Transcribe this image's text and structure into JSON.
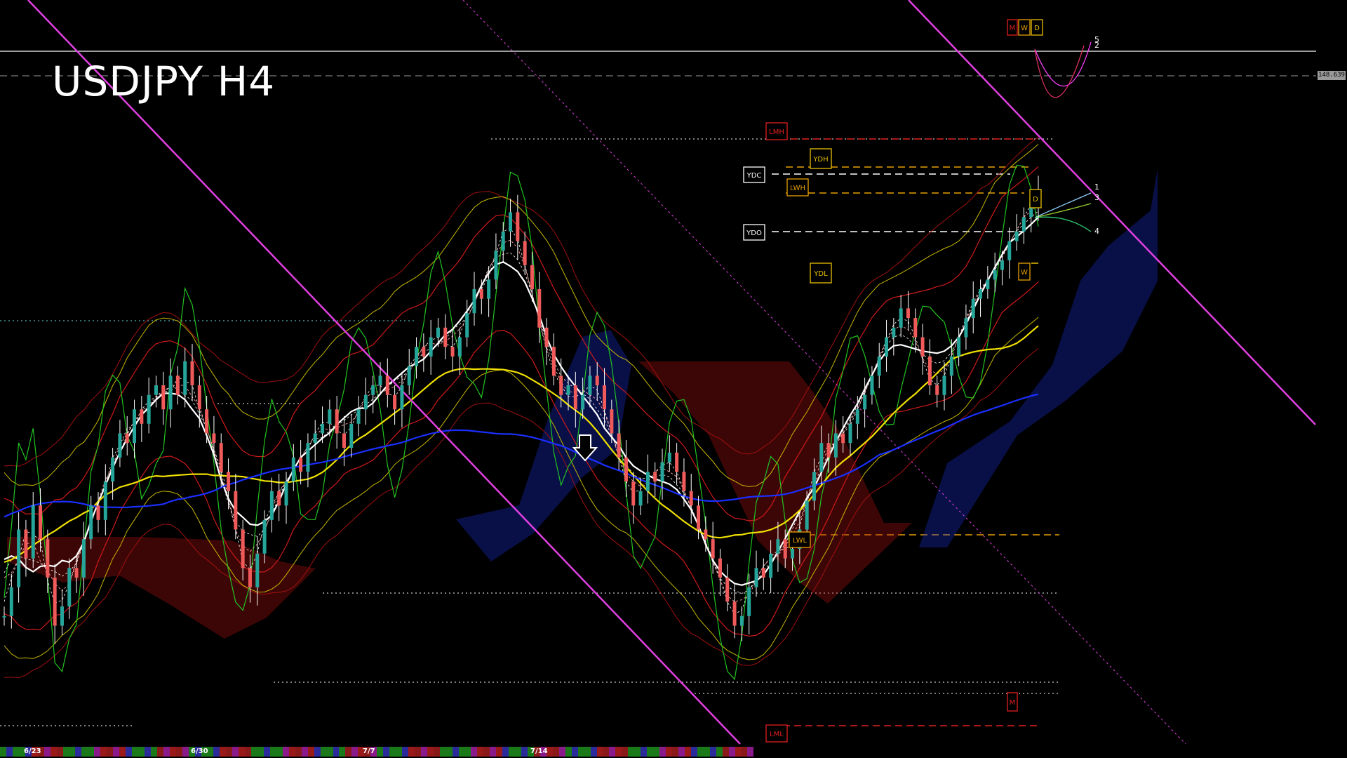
{
  "window": {
    "title": "USDJPY H4"
  },
  "price_tag": "148.639",
  "colors": {
    "bull": "#26a69a",
    "bear": "#f05a5a",
    "ma_white": "#ffffff",
    "ma_yellow": "#f0e000",
    "ma_blue": "#1a2fff",
    "channel": "#e040e0",
    "green_osc": "#22c422",
    "bollinger": "#d01a1a"
  },
  "x_axis_dates": [
    "6/23",
    "6/30",
    "7/7",
    "7/14"
  ],
  "level_boxes": [
    {
      "label": "M",
      "color": "#e02020"
    },
    {
      "label": "W",
      "color": "#e8a000"
    },
    {
      "label": "D",
      "color": "#e8c000"
    },
    {
      "label": "LMH",
      "color": "#e02020"
    },
    {
      "label": "YDH",
      "color": "#e8c000"
    },
    {
      "label": "YDC",
      "color": "#ffffff"
    },
    {
      "label": "LWH",
      "color": "#e8a000"
    },
    {
      "label": "YDO",
      "color": "#ffffff"
    },
    {
      "label": "YDL",
      "color": "#e8c000"
    },
    {
      "label": "LWL",
      "color": "#e8a000"
    },
    {
      "label": "D",
      "color": "#e8c000"
    },
    {
      "label": "W",
      "color": "#e8a000"
    },
    {
      "label": "M",
      "color": "#e02020"
    },
    {
      "label": "LML",
      "color": "#e02020"
    }
  ],
  "projection_labels": [
    "5",
    "2",
    "1",
    "3",
    "4"
  ],
  "chart_data": {
    "type": "candlestick",
    "title": "USDJPY H4",
    "symbol": "USDJPY",
    "timeframe": "H4",
    "x": [
      "6/23",
      "6/30",
      "7/7",
      "7/14"
    ],
    "current_price": 148.639,
    "ohlc_normalized_sequence": [
      0.12,
      0.18,
      0.3,
      0.24,
      0.35,
      0.28,
      0.2,
      0.1,
      0.14,
      0.22,
      0.2,
      0.28,
      0.35,
      0.32,
      0.4,
      0.45,
      0.5,
      0.48,
      0.55,
      0.52,
      0.58,
      0.6,
      0.55,
      0.62,
      0.58,
      0.65,
      0.6,
      0.55,
      0.5,
      0.48,
      0.42,
      0.38,
      0.3,
      0.22,
      0.18,
      0.25,
      0.32,
      0.38,
      0.35,
      0.4,
      0.45,
      0.42,
      0.48,
      0.5,
      0.52,
      0.55,
      0.5,
      0.47,
      0.52,
      0.55,
      0.58,
      0.6,
      0.62,
      0.58,
      0.55,
      0.6,
      0.64,
      0.68,
      0.66,
      0.7,
      0.72,
      0.68,
      0.66,
      0.7,
      0.75,
      0.8,
      0.78,
      0.82,
      0.88,
      0.92,
      0.96,
      0.9,
      0.85,
      0.8,
      0.72,
      0.68,
      0.62,
      0.58,
      0.6,
      0.55,
      0.58,
      0.62,
      0.6,
      0.55,
      0.5,
      0.45,
      0.4,
      0.35,
      0.38,
      0.42,
      0.4,
      0.44,
      0.46,
      0.42,
      0.38,
      0.35,
      0.3,
      0.28,
      0.24,
      0.2,
      0.15,
      0.1,
      0.12,
      0.18,
      0.22,
      0.2,
      0.25,
      0.28,
      0.24,
      0.26,
      0.3,
      0.36,
      0.42,
      0.48,
      0.45,
      0.5,
      0.48,
      0.52,
      0.55,
      0.58,
      0.62,
      0.66,
      0.7,
      0.72,
      0.76,
      0.74,
      0.7,
      0.66,
      0.6,
      0.58,
      0.62,
      0.66,
      0.7,
      0.74,
      0.78,
      0.8,
      0.82,
      0.84,
      0.86,
      0.9,
      0.92,
      0.95,
      0.98,
      1.0
    ]
  }
}
